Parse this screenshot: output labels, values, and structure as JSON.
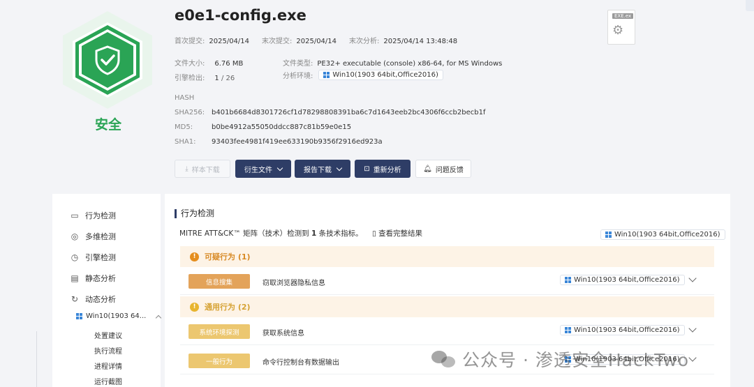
{
  "file": {
    "name": "e0e1-config.exe",
    "verdict": "安全",
    "first_submit_label": "首次提交:",
    "first_submit": "2025/04/14",
    "last_submit_label": "末次提交:",
    "last_submit": "2025/04/14",
    "last_analysis_label": "末次分析:",
    "last_analysis": "2025/04/14 13:48:48",
    "size_label": "文件大小:",
    "size": "6.76 MB",
    "type_label": "文件类型:",
    "type": "PE32+ executable (console) x86-64, for MS Windows",
    "engine_label": "引擎检出:",
    "engine_detect": "1",
    "engine_total": "/ 26",
    "env_label": "分析环境:",
    "env": "Win10(1903 64bit,Office2016)",
    "thumb_tag": "EXE.ex"
  },
  "hash": {
    "title": "HASH",
    "sha256_label": "SHA256:",
    "sha256": "b401b6684d8301726cf1d78298808391ba6c7d1643eeb2bc4306f6ccb2becb1f",
    "md5_label": "MD5:",
    "md5": "b0be4912a55050ddcc887c81b59e0e15",
    "sha1_label": "SHA1:",
    "sha1": "93403fee4981f419ee633190b9356f2916ed923a"
  },
  "toolbar": {
    "download": "样本下载",
    "derived": "衍生文件",
    "report": "报告下载",
    "reanalyze": "重新分析",
    "feedback": "问题反馈"
  },
  "sidebar": {
    "items": [
      {
        "label": "行为检测",
        "icon": "monitor-icon"
      },
      {
        "label": "多维检测",
        "icon": "radar-icon"
      },
      {
        "label": "引擎检测",
        "icon": "engine-icon"
      },
      {
        "label": "静态分析",
        "icon": "document-icon"
      },
      {
        "label": "动态分析",
        "icon": "refresh-icon"
      }
    ],
    "env_sub": "Win10(1903 64...",
    "leaves": [
      "处置建议",
      "执行流程",
      "进程详情",
      "运行截图"
    ]
  },
  "main": {
    "title": "行为检测",
    "mitre_prefix": "MITRE ATT&CK™ 矩阵（技术）检测到",
    "mitre_count": "1",
    "mitre_suffix": "条技术指标。",
    "view_full": "查看完整结果",
    "env": "Win10(1903 64bit,Office2016)",
    "groups": [
      {
        "title": "可疑行为 (1)",
        "rows": [
          {
            "tag": "信息搜集",
            "text": "窃取浏览器隐私信息",
            "env": "Win10(1903 64bit,Office2016)"
          }
        ]
      },
      {
        "title": "通用行为 (2)",
        "rows": [
          {
            "tag": "系统环境探测",
            "text": "获取系统信息",
            "env": "Win10(1903 64bit,Office2016)"
          },
          {
            "tag": "一般行为",
            "text": "命令行控制台有数据输出",
            "env": "Win10(1903 64bit,Office2016)"
          }
        ]
      }
    ]
  },
  "watermark": "公众号 · 渗透安全HackTwo",
  "colors": {
    "safe_green": "#2aa455",
    "navy": "#2e3d66",
    "suspicious_orange": "#e3a35a",
    "general_yellow": "#ecc770",
    "alert_red": "#e33e33"
  }
}
